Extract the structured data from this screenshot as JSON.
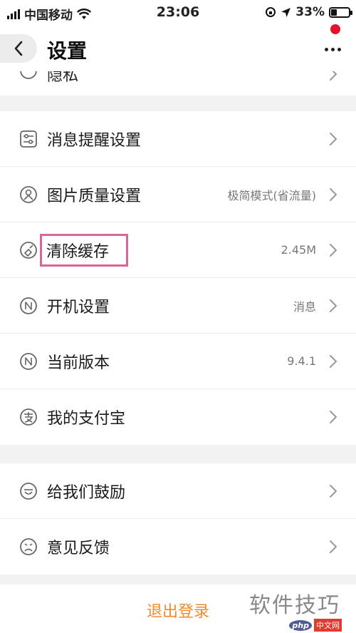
{
  "status_bar": {
    "carrier": "中国移动",
    "time": "23:06",
    "battery": "33%",
    "battery_level": 0.33
  },
  "nav": {
    "title": "设置"
  },
  "partial_row": {
    "label": "隐私"
  },
  "group1": [
    {
      "label": "消息提醒设置",
      "value": "",
      "icon": "sliders-icon"
    },
    {
      "label": "图片质量设置",
      "value": "极简模式(省流量)",
      "icon": "image-quality-icon"
    },
    {
      "label": "清除缓存",
      "value": "2.45M",
      "icon": "broom-icon"
    },
    {
      "label": "开机设置",
      "value": "消息",
      "icon": "n-circle-icon"
    },
    {
      "label": "当前版本",
      "value": "9.4.1",
      "icon": "n-circle-icon"
    },
    {
      "label": "我的支付宝",
      "value": "",
      "icon": "alipay-icon"
    }
  ],
  "group2": [
    {
      "label": "给我们鼓励",
      "value": "",
      "icon": "smile-icon"
    },
    {
      "label": "意见反馈",
      "value": "",
      "icon": "sad-face-icon"
    }
  ],
  "footer": {
    "logout_label": "退出登录"
  },
  "watermark": {
    "main": "软件技巧",
    "php": "php",
    "site": "中文网"
  }
}
